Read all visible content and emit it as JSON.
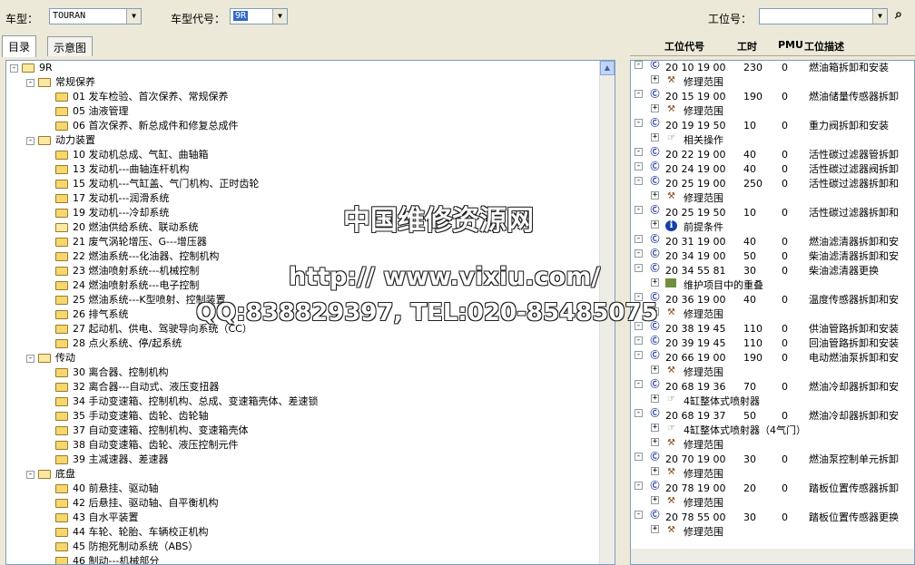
{
  "toolbar": {
    "model_label": "车型：",
    "model_value": "TOURAN",
    "code_label": "车型代号：",
    "code_value": "9R",
    "pos_label": "工位号：",
    "pos_value": ""
  },
  "tabs": [
    "目录",
    "示意图"
  ],
  "columns": [
    "工位代号",
    "工时",
    "PMU",
    "工位描述"
  ],
  "watermark": {
    "line1": "中国维修资源网",
    "line2": "http:// www.vixiu.com/",
    "line3": "QQ:838829397, TEL:020-85485075"
  },
  "tree": [
    {
      "d": 0,
      "t": "9R",
      "e": "-"
    },
    {
      "d": 1,
      "t": "常规保养",
      "e": "-"
    },
    {
      "d": 2,
      "t": "01 发车检验、首次保养、常规保养"
    },
    {
      "d": 2,
      "t": "05 油液管理"
    },
    {
      "d": 2,
      "t": "06 首次保养、新总成件和修复总成件"
    },
    {
      "d": 1,
      "t": "动力装置",
      "e": "-"
    },
    {
      "d": 2,
      "t": "10 发动机总成、气缸、曲轴箱"
    },
    {
      "d": 2,
      "t": "13 发动机---曲轴连杆机构"
    },
    {
      "d": 2,
      "t": "15 发动机---气缸盖、气门机构、正时齿轮"
    },
    {
      "d": 2,
      "t": "17 发动机---润滑系统"
    },
    {
      "d": 2,
      "t": "19 发动机---冷却系统"
    },
    {
      "d": 2,
      "t": "20 燃油供给系统、联动系统",
      "o": true
    },
    {
      "d": 2,
      "t": "21 废气涡轮增压、G---增压器"
    },
    {
      "d": 2,
      "t": "22 燃油系统---化油器、控制机构"
    },
    {
      "d": 2,
      "t": "23 燃油喷射系统---机械控制"
    },
    {
      "d": 2,
      "t": "24 燃油喷射系统---电子控制"
    },
    {
      "d": 2,
      "t": "25 燃油系统---K型喷射、控制装置"
    },
    {
      "d": 2,
      "t": "26 排气系统"
    },
    {
      "d": 2,
      "t": "27 起动机、供电、驾驶导向系统（CC）"
    },
    {
      "d": 2,
      "t": "28 点火系统、停/起系统"
    },
    {
      "d": 1,
      "t": "传动",
      "e": "-"
    },
    {
      "d": 2,
      "t": "30 离合器、控制机构"
    },
    {
      "d": 2,
      "t": "32 离合器---自动式、液压变扭器"
    },
    {
      "d": 2,
      "t": "34 手动变速箱、控制机构、总成、变速箱壳体、差速锁"
    },
    {
      "d": 2,
      "t": "35 手动变速箱、齿轮、齿轮轴"
    },
    {
      "d": 2,
      "t": "37 自动变速箱、控制机构、变速箱壳体"
    },
    {
      "d": 2,
      "t": "38 自动变速箱、齿轮、液压控制元件"
    },
    {
      "d": 2,
      "t": "39 主减速器、差速器"
    },
    {
      "d": 1,
      "t": "底盘",
      "e": "-"
    },
    {
      "d": 2,
      "t": "40 前悬挂、驱动轴"
    },
    {
      "d": 2,
      "t": "42 后悬挂、驱动轴、自平衡机构"
    },
    {
      "d": 2,
      "t": "43 自水平装置"
    },
    {
      "d": 2,
      "t": "44 车轮、轮胎、车辆校正机构"
    },
    {
      "d": 2,
      "t": "45 防抱死制动系统（ABS）"
    },
    {
      "d": 2,
      "t": "46 制动---机械部分"
    }
  ],
  "ops": [
    {
      "k": "op",
      "c": "20 10 19 00",
      "h": "230",
      "p": "0",
      "d": "燃油箱拆卸和安装"
    },
    {
      "k": "sub",
      "ic": "w",
      "t": "修理范围"
    },
    {
      "k": "op",
      "c": "20 15 19 00",
      "h": "190",
      "p": "0",
      "d": "燃油储量传感器拆卸"
    },
    {
      "k": "sub",
      "ic": "w",
      "t": "修理范围"
    },
    {
      "k": "op",
      "c": "20 19 19 50",
      "h": "10",
      "p": "0",
      "d": "重力阀拆卸和安装"
    },
    {
      "k": "sub",
      "ic": "h",
      "t": "相关操作"
    },
    {
      "k": "op",
      "c": "20 22 19 00",
      "h": "40",
      "p": "0",
      "d": "活性碳过滤器管拆卸"
    },
    {
      "k": "op",
      "c": "20 24 19 00",
      "h": "40",
      "p": "0",
      "d": "活性碳过滤器阀拆卸"
    },
    {
      "k": "op",
      "c": "20 25 19 00",
      "h": "250",
      "p": "0",
      "d": "活性碳过滤器拆卸和"
    },
    {
      "k": "sub",
      "ic": "w",
      "t": "修理范围"
    },
    {
      "k": "op",
      "c": "20 25 19 50",
      "h": "10",
      "p": "0",
      "d": "活性碳过滤器拆卸和"
    },
    {
      "k": "sub",
      "ic": "i",
      "t": "前提条件"
    },
    {
      "k": "op",
      "c": "20 31 19 00",
      "h": "40",
      "p": "0",
      "d": "燃油滤清器拆卸和安"
    },
    {
      "k": "op",
      "c": "20 34 19 00",
      "h": "50",
      "p": "0",
      "d": "柴油滤清器拆卸和安"
    },
    {
      "k": "op",
      "c": "20 34 55 81",
      "h": "30",
      "p": "0",
      "d": "柴油滤清器更换"
    },
    {
      "k": "sub",
      "ic": "g",
      "t": "维护项目中的重叠"
    },
    {
      "k": "op",
      "c": "20 36 19 00",
      "h": "40",
      "p": "0",
      "d": "温度传感器拆卸和安"
    },
    {
      "k": "sub",
      "ic": "w",
      "t": "修理范围"
    },
    {
      "k": "op",
      "c": "20 38 19 45",
      "h": "110",
      "p": "0",
      "d": "供油管路拆卸和安装"
    },
    {
      "k": "op",
      "c": "20 39 19 45",
      "h": "110",
      "p": "0",
      "d": "回油管路拆卸和安装"
    },
    {
      "k": "op",
      "c": "20 66 19 00",
      "h": "190",
      "p": "0",
      "d": "电动燃油泵拆卸和安"
    },
    {
      "k": "sub",
      "ic": "w",
      "t": "修理范围"
    },
    {
      "k": "op",
      "c": "20 68 19 36",
      "h": "70",
      "p": "0",
      "d": "燃油冷却器拆卸和安"
    },
    {
      "k": "sub",
      "ic": "h",
      "t": "4缸整体式喷射器"
    },
    {
      "k": "op",
      "c": "20 68 19 37",
      "h": "50",
      "p": "0",
      "d": "燃油冷却器拆卸和安"
    },
    {
      "k": "sub",
      "ic": "h",
      "t": "4缸整体式喷射器（4气门）"
    },
    {
      "k": "sub",
      "ic": "w",
      "t": "修理范围"
    },
    {
      "k": "op",
      "c": "20 70 19 00",
      "h": "30",
      "p": "0",
      "d": "燃油泵控制单元拆卸"
    },
    {
      "k": "sub",
      "ic": "w",
      "t": "修理范围"
    },
    {
      "k": "op",
      "c": "20 78 19 00",
      "h": "20",
      "p": "0",
      "d": "踏板位置传感器拆卸"
    },
    {
      "k": "sub",
      "ic": "w",
      "t": "修理范围"
    },
    {
      "k": "op",
      "c": "20 78 55 00",
      "h": "30",
      "p": "0",
      "d": "踏板位置传感器更换"
    },
    {
      "k": "sub",
      "ic": "w",
      "t": "修理范围"
    }
  ]
}
